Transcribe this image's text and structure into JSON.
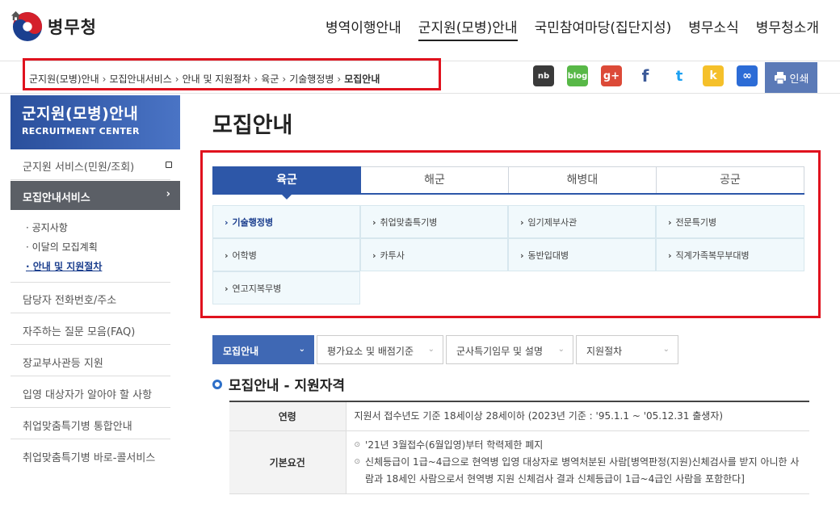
{
  "brand": {
    "name": "병무청"
  },
  "gnb": [
    "병역이행안내",
    "군지원(모병)안내",
    "국민참여마당(집단지성)",
    "병무소식",
    "병무청소개"
  ],
  "breadcrumb": [
    "군지원(모병)안내",
    "모집안내서비스",
    "안내 및 지원절차",
    "육군",
    "기술행정병",
    "모집안내"
  ],
  "sns": {
    "naver": "nb",
    "blog": "blog",
    "google": "g+",
    "facebook": "f",
    "twitter": "t",
    "kakao": "k",
    "link": "∞"
  },
  "print_label": "인쇄",
  "lnb": {
    "title": "군지원(모병)안내",
    "subtitle": "RECRUITMENT CENTER",
    "item_service": "군지원 서비스(민원/조회)",
    "item_active": "모집안내서비스",
    "subs": [
      "공지사항",
      "이달의 모집계획",
      "안내 및 지원절차"
    ],
    "items": [
      "담당자 전화번호/주소",
      "자주하는 질문 모음(FAQ)",
      "장교부사관등 지원",
      "입영 대상자가 알아야 할 사항",
      "취업맞춤특기병 통합안내",
      "취업맞춤특기병 바로-콜서비스"
    ]
  },
  "page_title": "모집안내",
  "mil_tabs": [
    "육군",
    "해군",
    "해병대",
    "공군"
  ],
  "sub_items": [
    "기술행정병",
    "취업맞춤특기병",
    "임기제부사관",
    "전문특기병",
    "어학병",
    "카투사",
    "동반입대병",
    "직계가족복무부대병",
    "연고지복무병"
  ],
  "dropdowns": [
    "모집안내",
    "평가요소 및 배점기준",
    "군사특기임무 및 설명",
    "지원절차"
  ],
  "section_title": "모집안내 - 지원자격",
  "table": {
    "age_label": "연령",
    "age_value": "지원서 접수년도 기준 18세이상 28세이하 (2023년 기준 : '95.1.1 ~ '05.12.31 출생자)",
    "basic_label": "기본요건",
    "basic_items": [
      "'21년 3월접수(6월입영)부터 학력제한 폐지",
      "신체등급이 1급~4급으로 현역병 입영 대상자로 병역처분된 사람[병역판정(지원)신체검사를 받지 아니한 사람과 18세인 사람으로서 현역병 지원 신체검사 결과 신체등급이 1급~4급인 사람을 포함한다]"
    ]
  }
}
